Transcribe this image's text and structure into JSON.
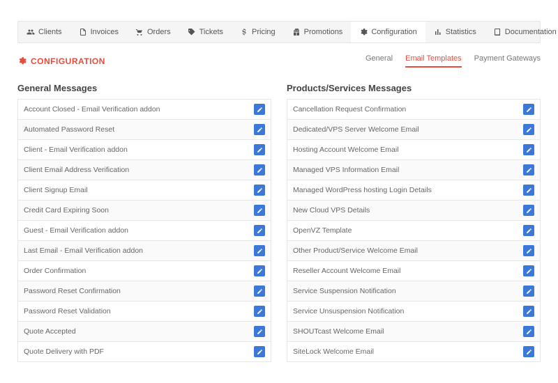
{
  "nav": [
    {
      "label": "Clients",
      "icon": "users"
    },
    {
      "label": "Invoices",
      "icon": "file"
    },
    {
      "label": "Orders",
      "icon": "cart"
    },
    {
      "label": "Tickets",
      "icon": "tag"
    },
    {
      "label": "Pricing",
      "icon": "dollar"
    },
    {
      "label": "Promotions",
      "icon": "gift"
    },
    {
      "label": "Configuration",
      "icon": "cogs",
      "active": true
    },
    {
      "label": "Statistics",
      "icon": "stats"
    },
    {
      "label": "Documentation",
      "icon": "book"
    }
  ],
  "page_title": "CONFIGURATION",
  "subtabs": [
    {
      "label": "General"
    },
    {
      "label": "Email Templates",
      "active": true
    },
    {
      "label": "Payment Gateways"
    }
  ],
  "left_heading": "General Messages",
  "right_heading": "Products/Services Messages",
  "left_items": [
    "Account Closed - Email Verification addon",
    "Automated Password Reset",
    "Client - Email Verification addon",
    "Client Email Address Verification",
    "Client Signup Email",
    "Credit Card Expiring Soon",
    "Guest - Email Verification addon",
    "Last Email - Email Verification addon",
    "Order Confirmation",
    "Password Reset Confirmation",
    "Password Reset Validation",
    "Quote Accepted",
    "Quote Delivery with PDF"
  ],
  "right_items": [
    "Cancellation Request Confirmation",
    "Dedicated/VPS Server Welcome Email",
    "Hosting Account Welcome Email",
    "Managed VPS Information Email",
    "Managed WordPress hosting Login Details",
    "New Cloud VPS Details",
    "OpenVZ Template",
    "Other Product/Service Welcome Email",
    "Reseller Account Welcome Email",
    "Service Suspension Notification",
    "Service Unsuspension Notification",
    "SHOUTcast Welcome Email",
    "SiteLock Welcome Email"
  ]
}
